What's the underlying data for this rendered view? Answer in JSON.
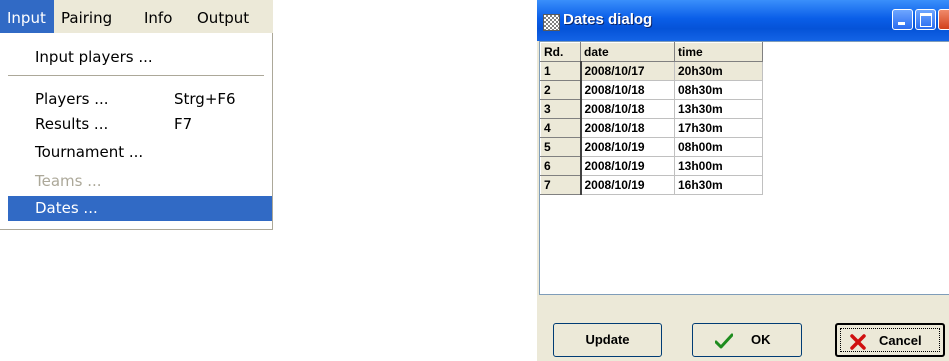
{
  "menubar": {
    "items": [
      {
        "label": "Input",
        "active": true
      },
      {
        "label": "Pairing"
      },
      {
        "label": "Info"
      },
      {
        "label": "Output"
      }
    ]
  },
  "input_menu": {
    "input_players": "Input players ...",
    "players": {
      "label": "Players ...",
      "shortcut": "Strg+F6"
    },
    "results": {
      "label": "Results ...",
      "shortcut": "F7"
    },
    "tournament": "Tournament ...",
    "teams": "Teams ...",
    "dates": "Dates ..."
  },
  "dialog": {
    "title": "Dates dialog",
    "columns": [
      "Rd.",
      "date",
      "time"
    ],
    "rows": [
      {
        "rd": "1",
        "date": "2008/10/17",
        "time": "20h30m"
      },
      {
        "rd": "2",
        "date": "2008/10/18",
        "time": "08h30m"
      },
      {
        "rd": "3",
        "date": "2008/10/18",
        "time": "13h30m"
      },
      {
        "rd": "4",
        "date": "2008/10/18",
        "time": "17h30m"
      },
      {
        "rd": "5",
        "date": "2008/10/19",
        "time": "08h00m"
      },
      {
        "rd": "6",
        "date": "2008/10/19",
        "time": "13h00m"
      },
      {
        "rd": "7",
        "date": "2008/10/19",
        "time": "16h30m"
      }
    ],
    "buttons": {
      "update": "Update",
      "ok": "OK",
      "cancel": "Cancel"
    }
  }
}
